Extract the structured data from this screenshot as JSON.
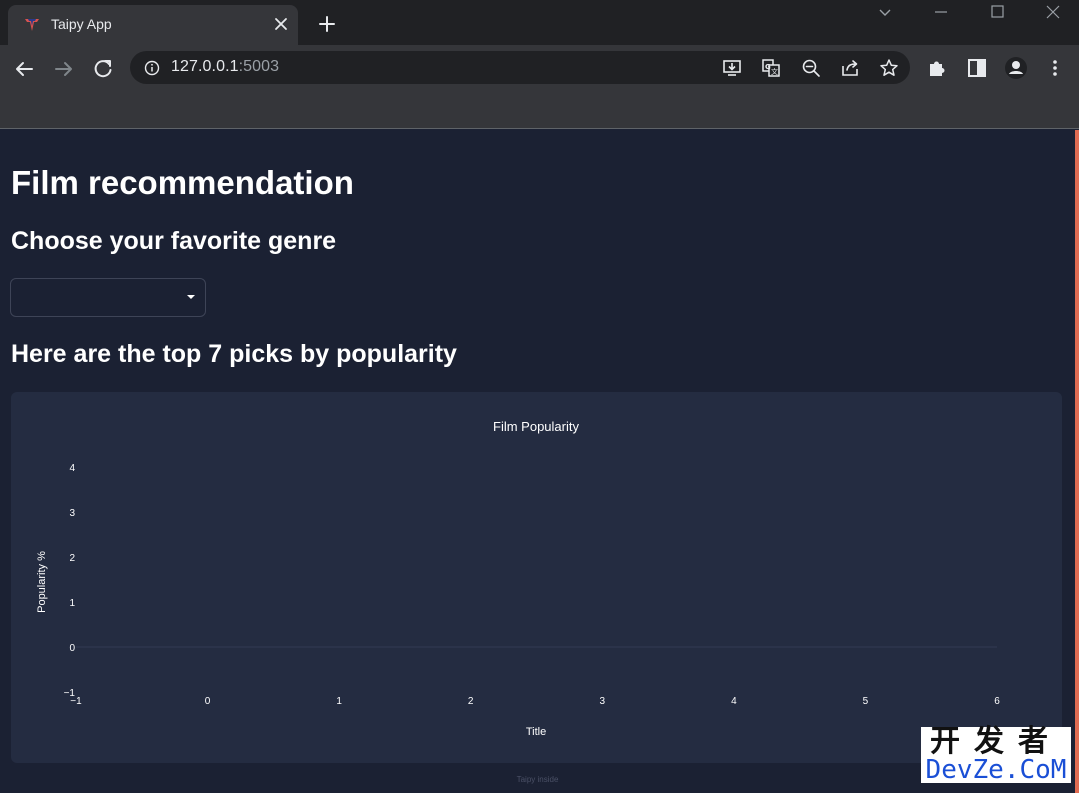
{
  "browser": {
    "tab_title": "Taipy App",
    "url_host": "127.0.0.1",
    "url_port": ":5003"
  },
  "page": {
    "title": "Film recommendation",
    "genre_heading": "Choose your favorite genre",
    "genre_select_value": "",
    "picks_heading": "Here are the top 7 picks by popularity",
    "footer": "Taipy inside"
  },
  "chart_data": {
    "type": "bar",
    "title": "Film Popularity",
    "xlabel": "Title",
    "ylabel": "Popularity %",
    "categories": [],
    "values": [],
    "xlim": [
      -1,
      6
    ],
    "ylim": [
      -1,
      4
    ],
    "x_ticks": [
      "−1",
      "0",
      "1",
      "2",
      "3",
      "4",
      "5",
      "6"
    ],
    "y_ticks": [
      "−1",
      "0",
      "1",
      "2",
      "3",
      "4"
    ],
    "grid": false
  },
  "watermark": {
    "line1": "开发者",
    "line2": "DevZe.CoM"
  },
  "colors": {
    "page_bg": "#1b2133",
    "card_bg": "#242c41",
    "accent_edge": "#e06c52"
  }
}
